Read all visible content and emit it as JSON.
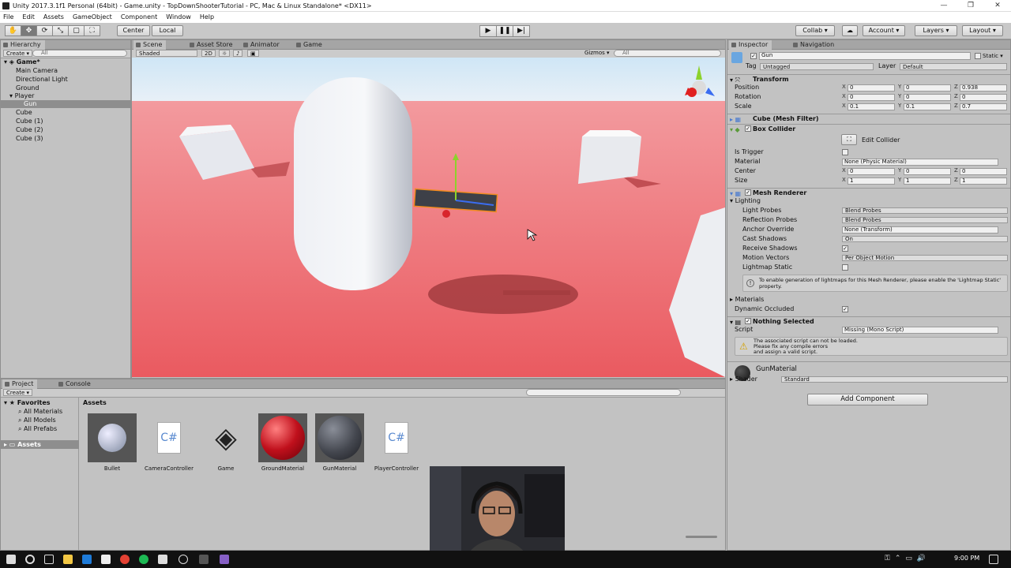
{
  "window": {
    "title": "Unity 2017.3.1f1 Personal (64bit) - Game.unity - TopDownShooterTutorial - PC, Mac & Linux Standalone* <DX11>",
    "min": "—",
    "max": "❐",
    "close": "✕"
  },
  "menu": [
    "File",
    "Edit",
    "Assets",
    "GameObject",
    "Component",
    "Window",
    "Help"
  ],
  "toolbar": {
    "tools": [
      "✋",
      "✥",
      "⟳",
      "⤡",
      "▢",
      "⛶"
    ],
    "pivot": "Center",
    "space": "Local",
    "play": "▶",
    "pause": "❚❚",
    "step": "▶|",
    "collab": "Collab ▾",
    "account": "Account ▾",
    "layers": "Layers ▾",
    "layout": "Layout ▾"
  },
  "hierarchy": {
    "tab": "Hierarchy",
    "create": "Create ▾",
    "search": "All",
    "scene": "Game*",
    "items": [
      "Main Camera",
      "Directional Light",
      "Ground",
      "Player",
      "Gun",
      "Cube",
      "Cube (1)",
      "Cube (2)",
      "Cube (3)"
    ]
  },
  "scene": {
    "tabs": [
      "Scene",
      "Asset Store",
      "Animator",
      "Game"
    ],
    "shading": "Shaded",
    "mode": "2D",
    "gizmos": "Gizmos ▾",
    "search": "All"
  },
  "inspector": {
    "tabs": [
      "Inspector",
      "Navigation"
    ],
    "object_name": "Gun",
    "static_label": "Static ▾",
    "tag_label": "Tag",
    "tag": "Untagged",
    "layer_label": "Layer",
    "layer": "Default",
    "transform": {
      "title": "Transform",
      "rows": [
        {
          "label": "Position",
          "x": "0",
          "y": "0",
          "z": "0.938"
        },
        {
          "label": "Rotation",
          "x": "0",
          "y": "0",
          "z": "0"
        },
        {
          "label": "Scale",
          "x": "0.1",
          "y": "0.1",
          "z": "0.7"
        }
      ]
    },
    "mesh_filter": "Cube (Mesh Filter)",
    "box_collider": {
      "title": "Box Collider",
      "edit": "Edit Collider",
      "is_trigger": "Is Trigger",
      "material_label": "Material",
      "material": "None (Physic Material)",
      "center_label": "Center",
      "center": [
        "0",
        "0",
        "0"
      ],
      "size_label": "Size",
      "size": [
        "1",
        "1",
        "1"
      ]
    },
    "mesh_renderer": {
      "title": "Mesh Renderer",
      "lighting": "Lighting",
      "rows": [
        {
          "label": "Light Probes",
          "value": "Blend Probes"
        },
        {
          "label": "Reflection Probes",
          "value": "Blend Probes"
        },
        {
          "label": "Anchor Override",
          "value": "None (Transform)"
        },
        {
          "label": "Cast Shadows",
          "value": "On"
        },
        {
          "label": "Receive Shadows",
          "value": "✓"
        },
        {
          "label": "Motion Vectors",
          "value": "Per Object Motion"
        },
        {
          "label": "Lightmap Static",
          "value": ""
        }
      ],
      "info": "To enable generation of lightmaps for this Mesh Renderer, please enable the 'Lightmap Static' property.",
      "materials": "Materials",
      "dynamic_occluded": "Dynamic Occluded"
    },
    "nothing_selected": {
      "title": "Nothing Selected",
      "script_label": "Script",
      "script": "Missing (Mono Script)",
      "warning": [
        "The associated script can not be loaded.",
        "Please fix any compile errors",
        "and assign a valid script."
      ]
    },
    "material": {
      "name": "GunMaterial",
      "shader_label": "Shader",
      "shader": "Standard"
    },
    "add_component": "Add Component"
  },
  "project": {
    "tabs": [
      "Project",
      "Console"
    ],
    "create": "Create ▾",
    "favorites": "Favorites",
    "fav_items": [
      "All Materials",
      "All Models",
      "All Prefabs"
    ],
    "assets_root": "Assets",
    "assets_header": "Assets",
    "assets": [
      "Bullet",
      "CameraController",
      "Game",
      "GroundMaterial",
      "GunMaterial",
      "PlayerController"
    ]
  },
  "taskbar": {
    "time": "9:00 PM"
  }
}
